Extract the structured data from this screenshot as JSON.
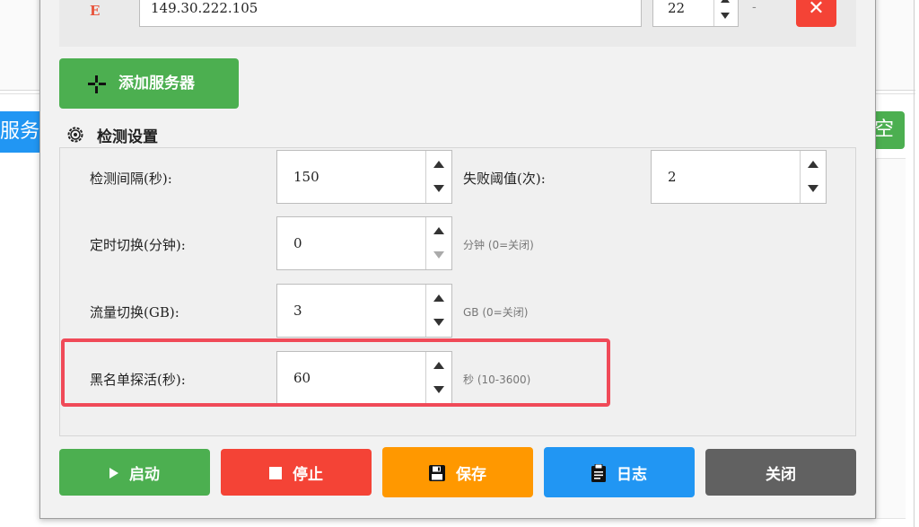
{
  "background": {
    "left_button_label": "服务器",
    "right_button_label": "空"
  },
  "server": {
    "label": "E",
    "ip": "149.30.222.105",
    "port": "22",
    "separator": "-",
    "delete_label": "✕"
  },
  "add_server_label": "添加服务器",
  "section_title": "检测设置",
  "fields": {
    "interval": {
      "label": "检测间隔(秒):",
      "value": "150"
    },
    "fail_threshold": {
      "label": "失败阈值(次):",
      "value": "2"
    },
    "timed_switch": {
      "label": "定时切换(分钟):",
      "value": "0",
      "hint": "分钟 (0=关闭)"
    },
    "traffic_switch": {
      "label": "流量切换(GB):",
      "value": "3",
      "hint": "GB (0=关闭)"
    },
    "blacklist_probe": {
      "label": "黑名单探活(秒):",
      "value": "60",
      "hint": "秒 (10-3600)"
    }
  },
  "buttons": {
    "start": "启动",
    "stop": "停止",
    "save": "保存",
    "log": "日志",
    "close": "关闭"
  },
  "colors": {
    "green": "#4caf50",
    "red": "#f44336",
    "orange": "#ff9800",
    "blue": "#2196f3",
    "gray": "#616161",
    "highlight": "#f04a58"
  }
}
